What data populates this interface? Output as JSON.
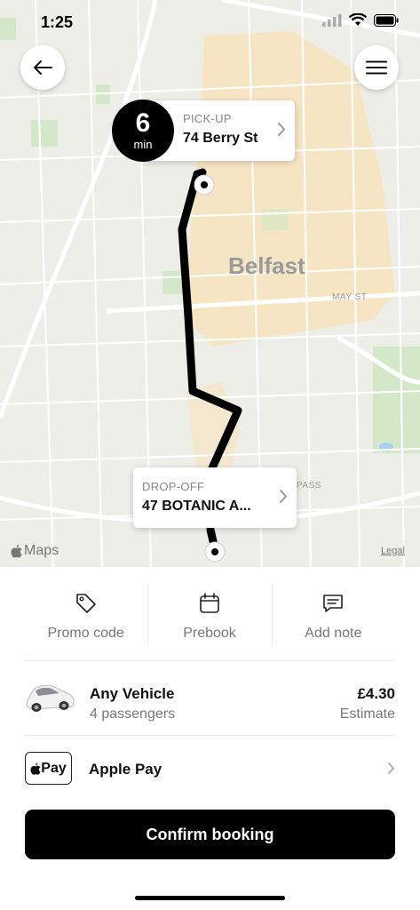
{
  "status_bar": {
    "time": "1:25"
  },
  "map": {
    "city_label": "Belfast",
    "street_labels": [
      "MAY ST",
      "PASS"
    ],
    "maps_credit": "Maps",
    "legal": "Legal"
  },
  "eta": {
    "value": "6",
    "unit": "min"
  },
  "pickup": {
    "kicker": "PICK-UP",
    "address": "74 Berry St"
  },
  "dropoff": {
    "kicker": "DROP-OFF",
    "address": "47 BOTANIC A..."
  },
  "actions": [
    {
      "label": "Promo code",
      "icon": "tag-icon"
    },
    {
      "label": "Prebook",
      "icon": "calendar-icon"
    },
    {
      "label": "Add note",
      "icon": "note-icon"
    }
  ],
  "vehicle": {
    "name": "Any Vehicle",
    "passengers": "4 passengers",
    "price": "£4.30",
    "price_note": "Estimate"
  },
  "payment": {
    "badge": "Pay",
    "label": "Apple Pay"
  },
  "confirm": {
    "label": "Confirm booking"
  },
  "colors": {
    "primary": "#000000",
    "map_bg": "#eeeee9",
    "map_district": "#f7e3bc",
    "map_park": "#d3e8c8"
  }
}
